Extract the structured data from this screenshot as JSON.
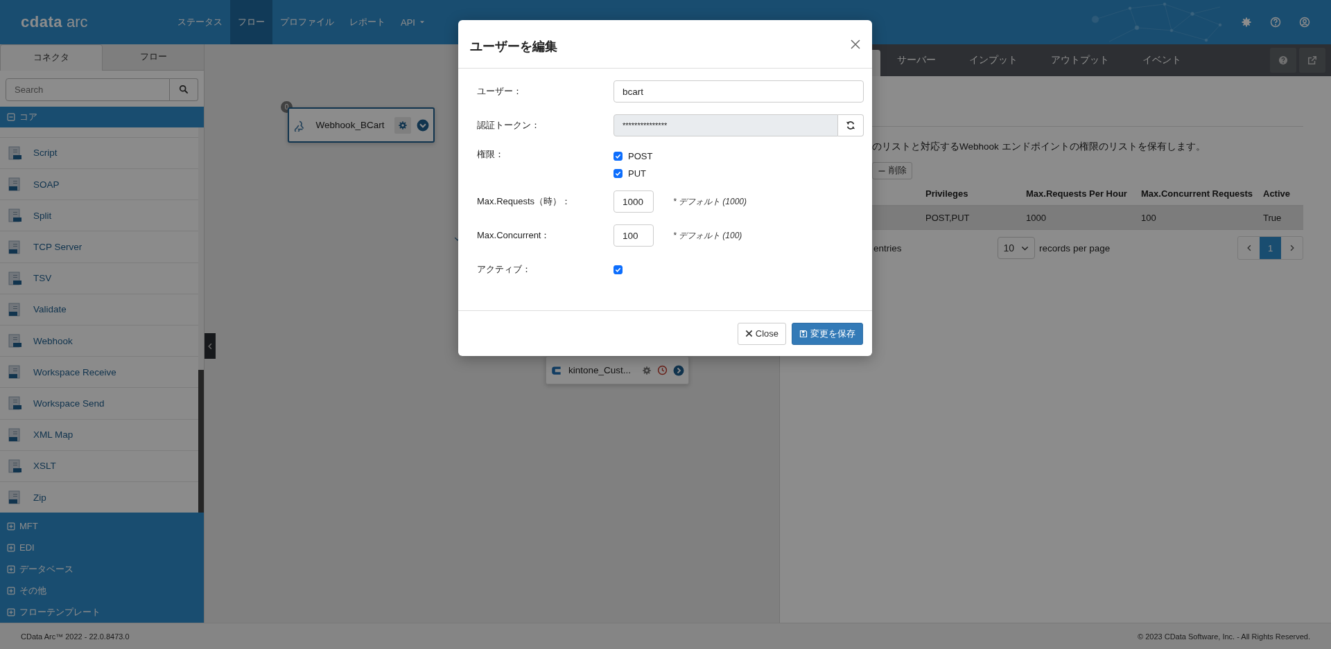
{
  "header": {
    "logo": {
      "brand": "cdata",
      "product": "arc"
    },
    "nav": [
      {
        "label": "ステータス",
        "selected": false,
        "dropdown": false
      },
      {
        "label": "フロー",
        "selected": true,
        "dropdown": false
      },
      {
        "label": "プロファイル",
        "selected": false,
        "dropdown": false
      },
      {
        "label": "レポート",
        "selected": false,
        "dropdown": false
      },
      {
        "label": "API",
        "selected": false,
        "dropdown": true
      }
    ]
  },
  "sidebar": {
    "tabs": [
      {
        "label": "コネクタ",
        "selected": true
      },
      {
        "label": "フロー",
        "selected": false
      }
    ],
    "search": {
      "placeholder": "Search"
    },
    "groups": [
      {
        "label": "コア",
        "expanded": true,
        "items": [
          "Script",
          "SOAP",
          "Split",
          "TCP Server",
          "TSV",
          "Validate",
          "Webhook",
          "Workspace Receive",
          "Workspace Send",
          "XML Map",
          "XSLT",
          "Zip"
        ]
      },
      {
        "label": "MFT",
        "expanded": false
      },
      {
        "label": "EDI",
        "expanded": false
      },
      {
        "label": "データベース",
        "expanded": false
      },
      {
        "label": "その他",
        "expanded": false
      },
      {
        "label": "フローテンプレート",
        "expanded": false
      }
    ]
  },
  "canvas": {
    "nodes": [
      {
        "label": "Webhook_BCart",
        "badge": "0",
        "kind": "source"
      },
      {
        "label": "kintone_Cust...",
        "kind": "target"
      }
    ]
  },
  "panel": {
    "tabs": [
      {
        "label": "サーバー",
        "selected": false
      },
      {
        "label": "インプット",
        "selected": false
      },
      {
        "label": "アウトプット",
        "selected": false
      },
      {
        "label": "イベント",
        "selected": false
      }
    ],
    "description": "のリストと対応するWebhook エンドポイントの権限のリストを保有します。",
    "delete_button": "削除",
    "table": {
      "columns": [
        "Privileges",
        "Max.Requests Per Hour",
        "Max.Concurrent Requests",
        "Active"
      ],
      "rows": [
        {
          "cells": [
            "POST,PUT",
            "1000",
            "100",
            "True"
          ],
          "selected": true
        }
      ]
    },
    "entries": "entries",
    "page_size": "10",
    "page_size_label": "records per page",
    "pages": [
      {
        "label": "1",
        "selected": true
      }
    ]
  },
  "footer": {
    "version": "CData Arc™ 2022 - 22.0.8473.0",
    "copyright": "© 2023 CData Software, Inc. - All Rights Reserved."
  },
  "modal": {
    "title": "ユーザーを編集",
    "fields": [
      {
        "kind": "text",
        "label": "ユーザー：",
        "value": "bcart"
      },
      {
        "kind": "token",
        "label": "認証トークン：",
        "value": "***************",
        "disabled": true
      },
      {
        "kind": "checks",
        "label": "権限：",
        "options": [
          {
            "label": "POST",
            "checked": true
          },
          {
            "label": "PUT",
            "checked": true
          }
        ]
      },
      {
        "kind": "number",
        "label": "Max.Requests（時）：",
        "value": "1000",
        "hint": "* デフォルト (1000)"
      },
      {
        "kind": "number",
        "label": "Max.Concurrent：",
        "value": "100",
        "hint": "* デフォルト (100)"
      },
      {
        "kind": "toggle",
        "label": "アクティブ：",
        "checked": true
      }
    ],
    "buttons": [
      {
        "label": "Close",
        "kind": "secondary"
      },
      {
        "label": "変更を保存",
        "kind": "primary"
      }
    ]
  }
}
